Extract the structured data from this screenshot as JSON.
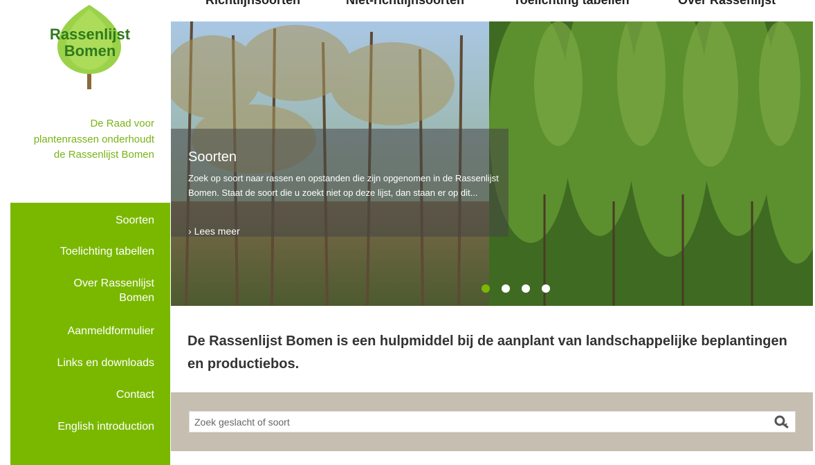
{
  "topnav": {
    "items": [
      "Richtlijnsoorten",
      "Niet-richtlijnsoorten",
      "Toelichting tabellen",
      "Over Rassenlijst"
    ]
  },
  "logo": {
    "line1": "Rassenlijst",
    "line2": "Bomen"
  },
  "tagline": "De Raad voor plantenrassen onderhoudt de Rassenlijst Bomen",
  "sidebar": {
    "items": [
      "Soorten",
      "Toelichting tabellen",
      "Over Rassenlijst Bomen",
      "Aanmeldformulier",
      "Links en downloads",
      "Contact",
      "English introduction"
    ]
  },
  "hero": {
    "title": "Soorten",
    "text": "Zoek op soort naar rassen en opstanden die zijn opgenomen in de Rassenlijst Bomen. Staat de soort die u zoekt niet op deze lijst, dan staan er op dit...",
    "more": "Lees meer",
    "slides": 4,
    "active_slide": 1
  },
  "intro": "De Rassenlijst Bomen is een hulpmiddel bij de aanplant van landschappelijke beplantingen en productiebos.",
  "search": {
    "placeholder": "Zoek geslacht of soort",
    "value": "",
    "icon": "search-key-icon"
  },
  "colors": {
    "brand_green": "#7ab800",
    "tagline_green": "#7ab317",
    "search_band": "#c6beb0"
  }
}
